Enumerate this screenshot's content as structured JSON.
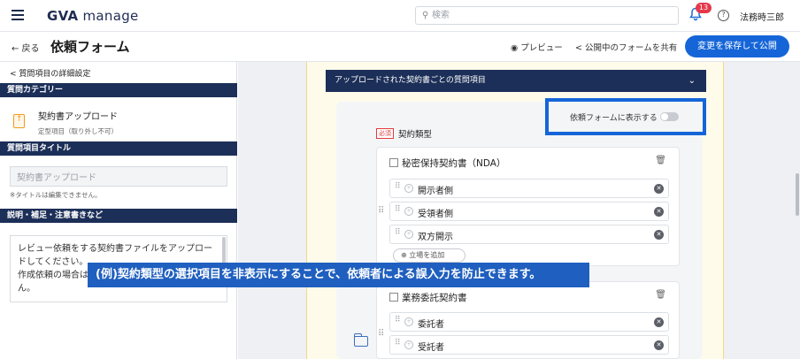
{
  "header": {
    "logo_bold": "GVA",
    "logo_light": " manage",
    "search_placeholder": "検索",
    "notification_count": "13",
    "help_glyph": "?",
    "user_name": "法務時三郎"
  },
  "subheader": {
    "back_label": "← 戻る",
    "page_title": "依頼フォーム",
    "preview_label": "◉ プレビュー",
    "share_label": "< 公開中のフォームを共有",
    "publish_label": "変更を保存して公開"
  },
  "left_panel": {
    "back_label": "< 質問項目の詳細設定",
    "category_header": "質問カテゴリー",
    "category_name": "契約書アップロード",
    "category_sub": "定型項目（取り外し不可）",
    "title_header": "質問項目タイトル",
    "title_value": "契約書アップロード",
    "title_note": "※タイトルは編集できません。",
    "desc_header": "説明・補足・注意書きなど",
    "desc_text": "レビュー依頼をする契約書ファイルをアップロードしてください。\n作成依頼の場合は…\nん。"
  },
  "form": {
    "section_title": "アップロードされた契約書ごとの質問項目",
    "section_chevron": "⌄",
    "toggle_label": "依頼フォームに表示する",
    "required_badge": "必須",
    "field_title": "契約類型",
    "groups": [
      {
        "name": "秘密保持契約書（NDA）",
        "options": [
          "開示者側",
          "受領者側",
          "双方開示"
        ]
      },
      {
        "name": "業務委託契約書",
        "options": [
          "委託者",
          "受託者"
        ]
      }
    ],
    "add_option_label": "⊕ 立場を追加"
  },
  "overlay": {
    "text": "(例)契約類型の選択項目を非表示にすることで、依頼者による誤入力を防止できます。"
  },
  "colors": {
    "navy": "#1c2f58",
    "primary": "#1565d8",
    "badge_red": "#e5384a",
    "form_bg": "#fffbea"
  }
}
